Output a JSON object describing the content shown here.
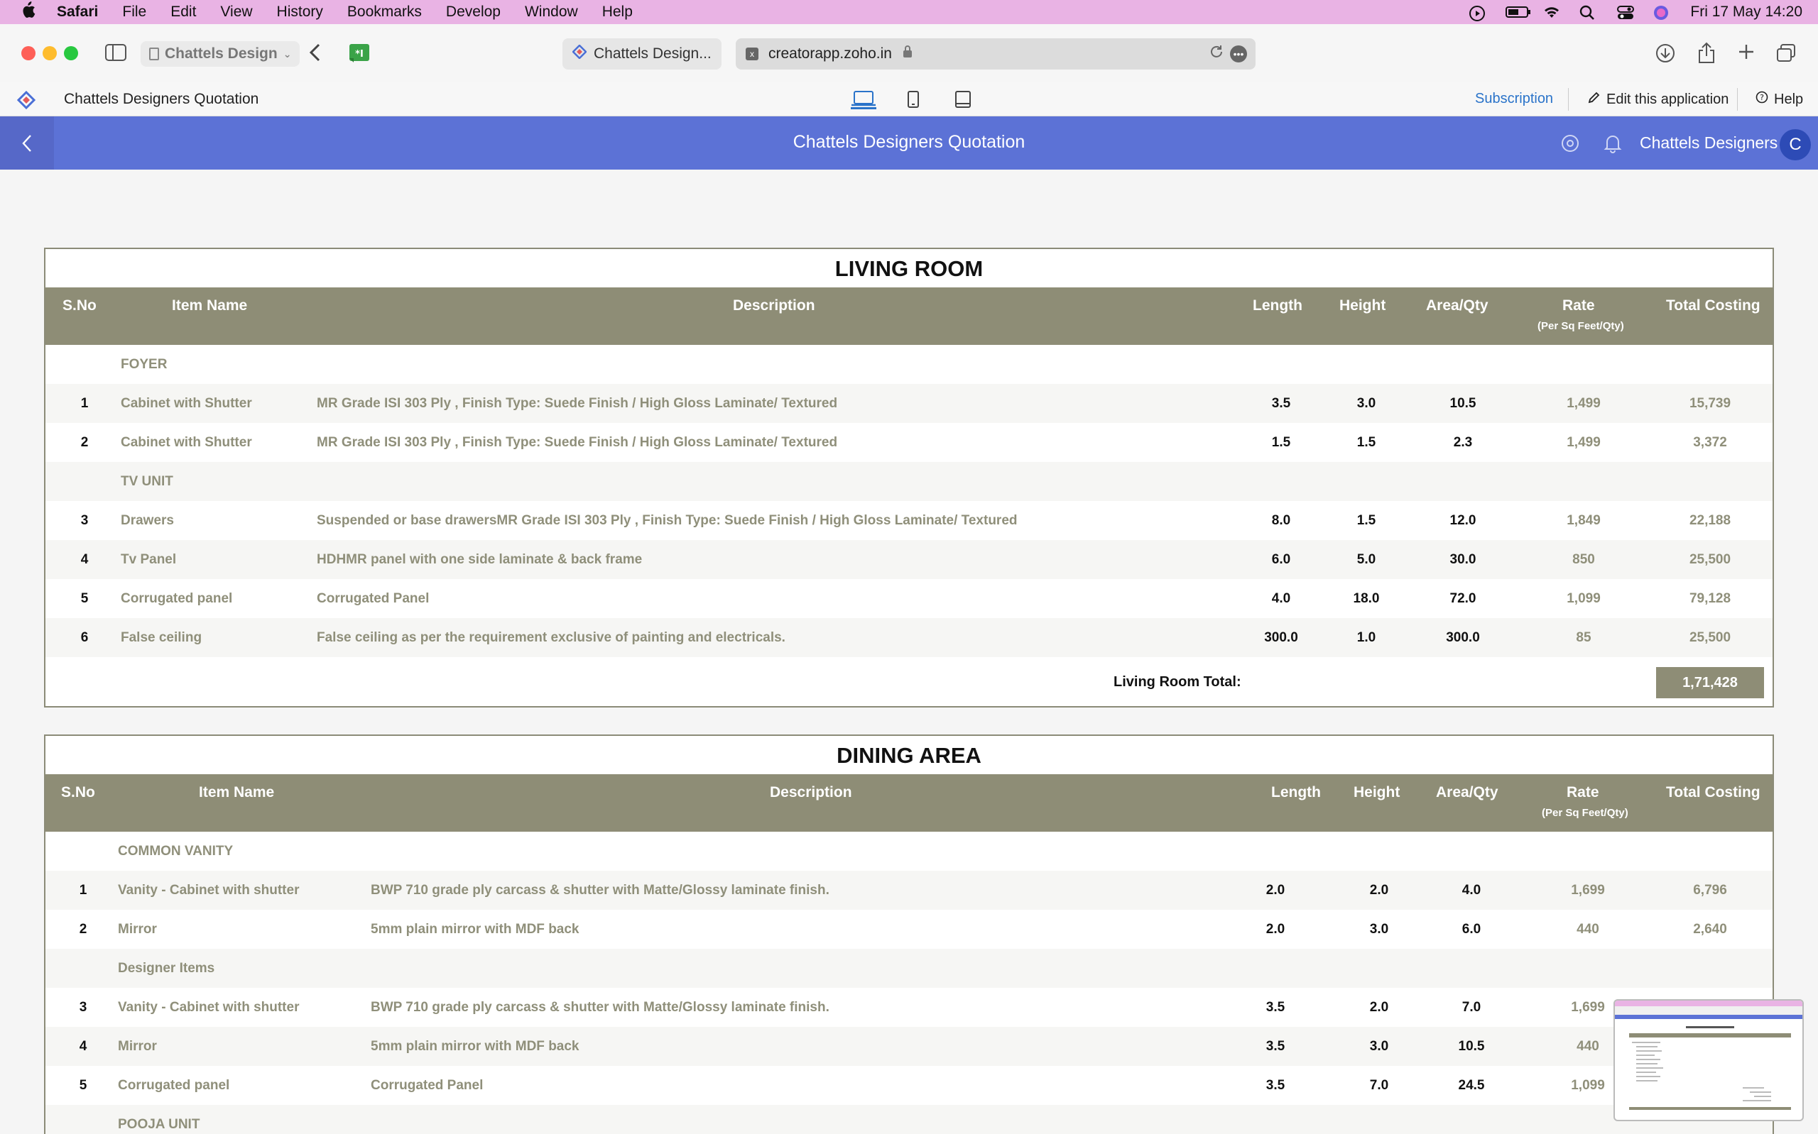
{
  "menubar": {
    "items": [
      "Safari",
      "File",
      "Edit",
      "View",
      "History",
      "Bookmarks",
      "Develop",
      "Window",
      "Help"
    ],
    "datetime": "Fri 17 May  14:20"
  },
  "browser": {
    "tab_group": "Chattels Design",
    "tab_title": "Chattels Design...",
    "url": "creatorapp.zoho.in"
  },
  "app": {
    "title": "Chattels Designers Quotation",
    "subscription": "Subscription",
    "edit": "Edit this application",
    "help": "Help"
  },
  "header": {
    "title": "Chattels Designers Quotation",
    "user": "Chattels Designers",
    "avatar_letter": "C"
  },
  "living_room": {
    "title": "LIVING ROOM",
    "cols": {
      "sno": "S.No",
      "item": "Item Name",
      "desc": "Description",
      "length": "Length",
      "height": "Height",
      "area": "Area/Qty",
      "rate": "Rate",
      "rate_sub": "(Per Sq Feet/Qty)",
      "total": "Total Costing"
    },
    "groups": {
      "g1": "FOYER",
      "g2": "TV UNIT"
    },
    "rows": [
      {
        "sno": "1",
        "item": "Cabinet with Shutter",
        "desc": "MR Grade ISI 303 Ply , Finish Type: Suede Finish / High Gloss Laminate/ Textured",
        "length": "3.5",
        "height": "3.0",
        "area": "10.5",
        "rate": "1,499",
        "total": "15,739"
      },
      {
        "sno": "2",
        "item": "Cabinet with Shutter",
        "desc": "MR Grade ISI 303 Ply , Finish Type: Suede Finish / High Gloss Laminate/ Textured",
        "length": "1.5",
        "height": "1.5",
        "area": "2.3",
        "rate": "1,499",
        "total": "3,372"
      },
      {
        "sno": "3",
        "item": "Drawers",
        "desc": "Suspended or base drawersMR Grade ISI 303 Ply , Finish Type: Suede Finish / High Gloss Laminate/ Textured",
        "length": "8.0",
        "height": "1.5",
        "area": "12.0",
        "rate": "1,849",
        "total": "22,188"
      },
      {
        "sno": "4",
        "item": "Tv Panel",
        "desc": "HDHMR panel with one side laminate & back frame",
        "length": "6.0",
        "height": "5.0",
        "area": "30.0",
        "rate": "850",
        "total": "25,500"
      },
      {
        "sno": "5",
        "item": "Corrugated panel",
        "desc": "Corrugated Panel",
        "length": "4.0",
        "height": "18.0",
        "area": "72.0",
        "rate": "1,099",
        "total": "79,128"
      },
      {
        "sno": "6",
        "item": "False ceiling",
        "desc": "False ceiling as per the requirement exclusive of painting and electricals.",
        "length": "300.0",
        "height": "1.0",
        "area": "300.0",
        "rate": "85",
        "total": "25,500"
      }
    ],
    "total_label": "Living Room Total:",
    "total_value": "1,71,428"
  },
  "dining": {
    "title": "DINING AREA",
    "cols": {
      "sno": "S.No",
      "item": "Item Name",
      "desc": "Description",
      "length": "Length",
      "height": "Height",
      "area": "Area/Qty",
      "rate": "Rate",
      "rate_sub": "(Per Sq Feet/Qty)",
      "total": "Total Costing"
    },
    "groups": {
      "g1": "COMMON VANITY",
      "g2": "Designer Items",
      "g3": "POOJA UNIT"
    },
    "rows": [
      {
        "sno": "1",
        "item": "Vanity - Cabinet with shutter",
        "desc": "BWP 710 grade ply carcass & shutter with Matte/Glossy laminate finish.",
        "length": "2.0",
        "height": "2.0",
        "area": "4.0",
        "rate": "1,699",
        "total": "6,796"
      },
      {
        "sno": "2",
        "item": "Mirror",
        "desc": "5mm plain mirror with MDF back",
        "length": "2.0",
        "height": "3.0",
        "area": "6.0",
        "rate": "440",
        "total": "2,640"
      },
      {
        "sno": "3",
        "item": "Vanity - Cabinet with shutter",
        "desc": "BWP 710 grade ply carcass & shutter with Matte/Glossy laminate finish.",
        "length": "3.5",
        "height": "2.0",
        "area": "7.0",
        "rate": "1,699",
        "total": ""
      },
      {
        "sno": "4",
        "item": "Mirror",
        "desc": "5mm plain mirror with MDF back",
        "length": "3.5",
        "height": "3.0",
        "area": "10.5",
        "rate": "440",
        "total": ""
      },
      {
        "sno": "5",
        "item": "Corrugated panel",
        "desc": "Corrugated Panel",
        "length": "3.5",
        "height": "7.0",
        "area": "24.5",
        "rate": "1,099",
        "total": ""
      }
    ]
  }
}
